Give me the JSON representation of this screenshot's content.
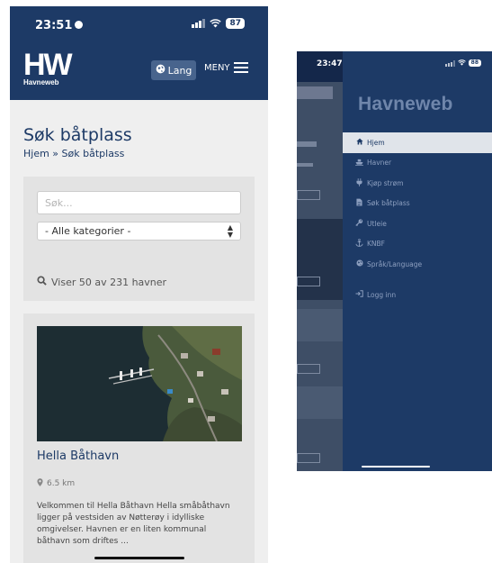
{
  "left": {
    "status": {
      "time": "23:51",
      "battery": "87"
    },
    "header": {
      "logo": "HW",
      "logo_sub": "Havneweb",
      "lang_label": "Lang",
      "menu_label": "MENY"
    },
    "page_title": "Søk båtplass",
    "breadcrumb": "Hjem » Søk båtplass",
    "search": {
      "placeholder": "Søk...",
      "category_selected": "- Alle kategorier -",
      "result_count": "Viser 50 av 231 havner"
    },
    "card": {
      "title": "Hella Båthavn",
      "distance": "6.5 km",
      "description": "Velkommen til Hella  Båthavn Hella småbåthavn ligger på vestsiden av Nøtterøy i idylliske omgivelser. Havnen er en liten kommunal båthavn som driftes ..."
    }
  },
  "right": {
    "status": {
      "time": "23:47",
      "battery": "88"
    },
    "drawer_logo": "Havneweb",
    "menu": [
      {
        "label": "Hjem",
        "icon": "home-icon",
        "active": true
      },
      {
        "label": "Havner",
        "icon": "ship-icon",
        "active": false
      },
      {
        "label": "Kjøp strøm",
        "icon": "plug-icon",
        "active": false
      },
      {
        "label": "Søk båtplass",
        "icon": "document-icon",
        "active": false
      },
      {
        "label": "Utleie",
        "icon": "key-icon",
        "active": false
      },
      {
        "label": "KNBF",
        "icon": "anchor-icon",
        "active": false
      },
      {
        "label": "Språk/Language",
        "icon": "globe-icon",
        "active": false
      }
    ],
    "login_label": "Logg inn"
  },
  "colors": {
    "brand_navy": "#1d3a66",
    "panel_gray": "#e3e3e3",
    "active_item": "#e0e4ea"
  }
}
